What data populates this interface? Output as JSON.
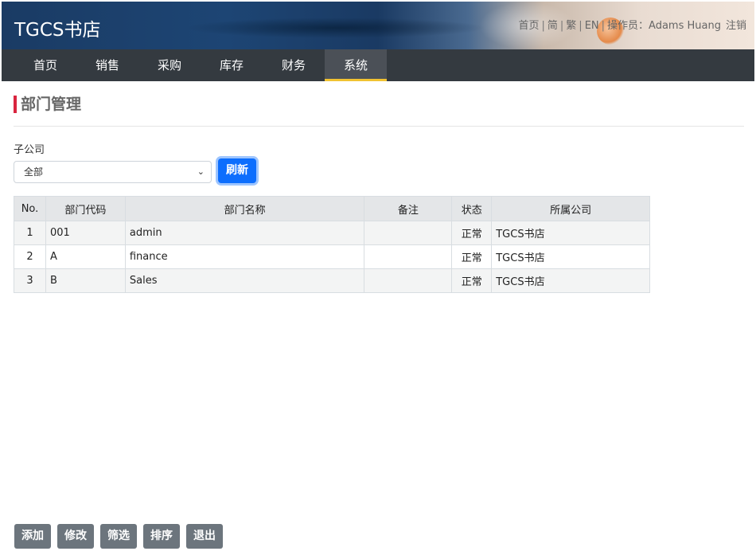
{
  "header": {
    "brand": "TGCS书店",
    "links": {
      "home": "首页",
      "simplified": "简",
      "traditional": "繁",
      "english": "EN",
      "operator_label": "操作员：",
      "operator_name": "Adams Huang",
      "logout": "注销"
    }
  },
  "nav": {
    "items": [
      {
        "label": "首页"
      },
      {
        "label": "销售"
      },
      {
        "label": "采购"
      },
      {
        "label": "库存"
      },
      {
        "label": "财务"
      },
      {
        "label": "系统"
      }
    ],
    "active": "系统"
  },
  "page": {
    "title": "部门管理",
    "accent_color": "#d9253f"
  },
  "filter": {
    "label": "子公司",
    "selected": "全部",
    "refresh_label": "刷新"
  },
  "table": {
    "headers": [
      "No.",
      "部门代码",
      "部门名称",
      "备注",
      "状态",
      "所属公司"
    ],
    "rows": [
      [
        "1",
        "001",
        "admin",
        "",
        "正常",
        "TGCS书店"
      ],
      [
        "2",
        "A",
        "finance",
        "",
        "正常",
        "TGCS书店"
      ],
      [
        "3",
        "B",
        "Sales",
        "",
        "正常",
        "TGCS书店"
      ]
    ]
  },
  "actions": {
    "add": "添加",
    "edit": "修改",
    "filter": "筛选",
    "sort": "排序",
    "exit": "退出"
  },
  "colors": {
    "navbar": "#343a40",
    "active_underline": "#f1c232",
    "primary": "#0d6efd",
    "secondary": "#6c757d"
  }
}
